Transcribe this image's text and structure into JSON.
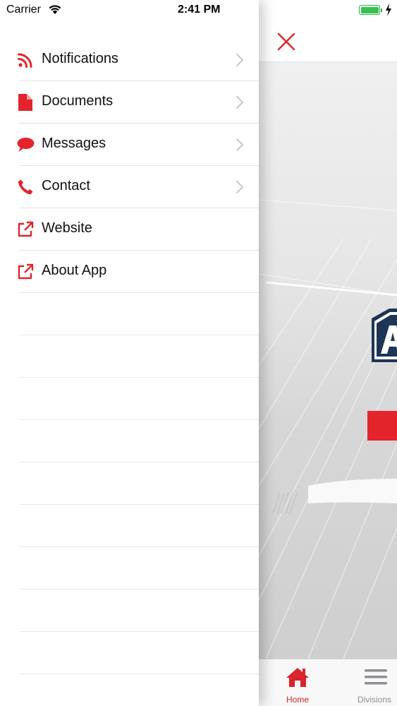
{
  "status_bar": {
    "carrier": "Carrier",
    "time": "2:41 PM"
  },
  "drawer": {
    "accent_color": "#e3242b",
    "items": [
      {
        "label": "Notifications",
        "icon": "rss-icon",
        "has_chevron": true
      },
      {
        "label": "Documents",
        "icon": "document-icon",
        "has_chevron": true
      },
      {
        "label": "Messages",
        "icon": "chat-bubble-icon",
        "has_chevron": true
      },
      {
        "label": "Contact",
        "icon": "phone-icon",
        "has_chevron": true
      },
      {
        "label": "Website",
        "icon": "external-link-icon",
        "has_chevron": false
      },
      {
        "label": "About App",
        "icon": "external-link-icon",
        "has_chevron": false
      }
    ]
  },
  "main": {
    "close_icon": "close-icon",
    "tabs": [
      {
        "label": "Home",
        "icon": "home-icon",
        "active": true
      },
      {
        "label": "Divisions",
        "icon": "menu-icon",
        "active": false
      }
    ]
  }
}
